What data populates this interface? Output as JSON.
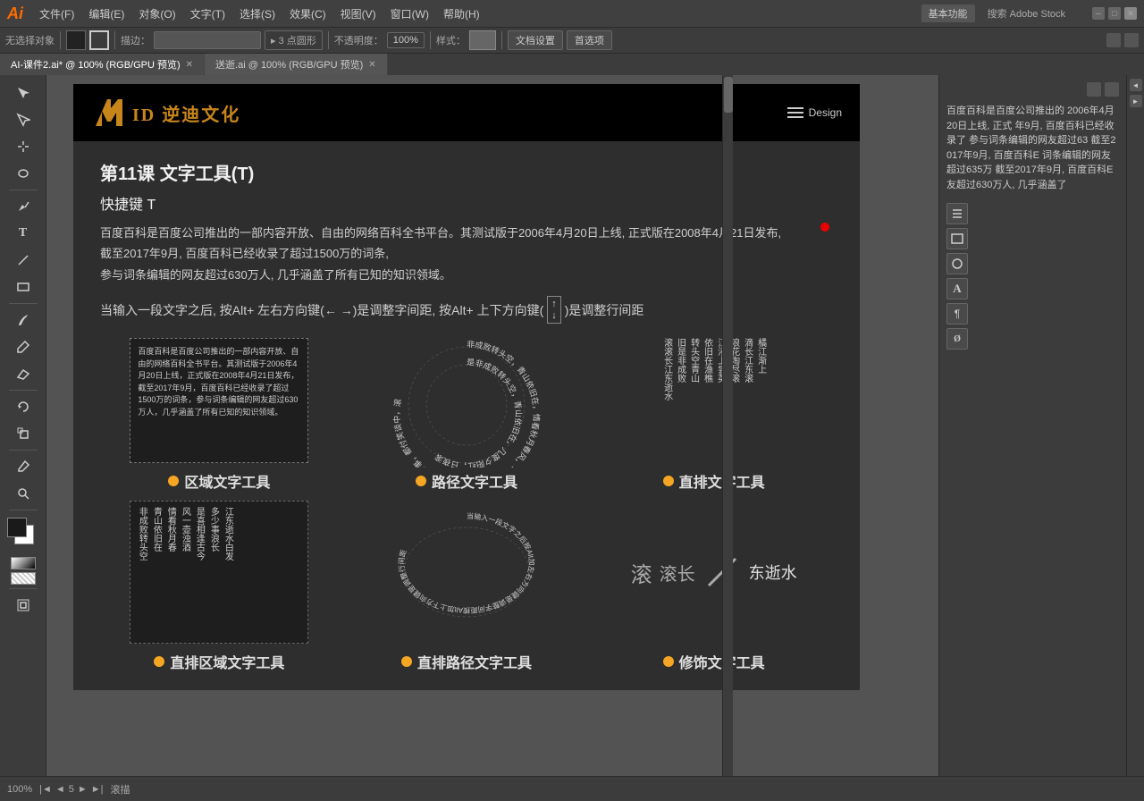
{
  "app": {
    "logo": "Ai",
    "menu_items": [
      "文件(F)",
      "编辑(E)",
      "对象(O)",
      "文字(T)",
      "选择(S)",
      "效果(C)",
      "视图(V)",
      "窗口(W)",
      "帮助(H)"
    ],
    "right_menu": [
      "基本功能",
      "搜索 Adobe Stock"
    ],
    "workspace_label": "基本功能"
  },
  "toolbar": {
    "no_selection": "无选择对象",
    "fill_label": "",
    "stroke_label": "",
    "scatter": "描边：",
    "points": "▸ 3 点圆形",
    "opacity_label": "不透明度：",
    "opacity_value": "100%",
    "style_label": "样式：",
    "doc_settings": "文档设置",
    "preferences": "首选项"
  },
  "tabs": [
    {
      "label": "AI-课件2.ai* @ 100% (RGB/GPU 预览)",
      "active": true
    },
    {
      "label": "送逝.ai @ 100% (RGB/GPU 预览)",
      "active": false
    }
  ],
  "slide": {
    "brand": "ID 逆迪文化",
    "design_menu": "Design",
    "lesson_title": "第11课   文字工具(T)",
    "shortcut": "快捷键 T",
    "desc_text": "百度百科是百度公司推出的一部内容开放、自由的网络百科全书平台。其测试版于2006年4月20日上线, 正式版在2008年4月21日发布,\n截至2017年9月, 百度百科已经收录了超过1500万的词条,\n参与词条编辑的网友超过630万人, 几乎涵盖了所有已知的知识领域。",
    "alt_text": "当输入一段文字之后, 按Alt+ 左右方向键(← →)是调整字间距, 按Alt+ 上下方向键(   )是调整行间距",
    "tools": [
      {
        "id": "area-text",
        "label": "区域文字工具",
        "sample_text": "百度百科是百度公司推出的一部内容开放、自由的网络百科全书平台。其测试版于2006年4月20日上线，正式版在2008年4月21日发布，截至2017年9月，百度百科已经收录了超过1500万的词条，参与词条编辑的网友超过630万人，几乎涵盖了所有已知的知识领域。"
      },
      {
        "id": "path-text",
        "label": "路径文字工具",
        "sample_text": "非成败转头空，青山依旧在，情看秋月春风，一壶浊酒喜相逢，古今多少事，都付笑谈中，滚滚长江东逝水，浪花淘尽英雄，是非成败转头空，青山依旧在，几度夕阳红，日夜滚滚长江东逝水"
      },
      {
        "id": "vertical-text",
        "label": "直排文字工具",
        "sample_text": "滚滚长江东逝水旧是非成败转头空青山依旧在渔樵江渚上尝英浪花淘尽滚滴长江东滚橘江渐上"
      }
    ],
    "tools_bottom": [
      {
        "id": "vertical-area",
        "label": "直排区域文字工具"
      },
      {
        "id": "vertical-path",
        "label": "直排路径文字工具"
      },
      {
        "id": "decoration",
        "label": "修饰文字工具"
      }
    ]
  },
  "right_panel": {
    "text": "百度百科是百度公司推出的 2006年4月20日上线, 正式 年9月, 百度百科已经收录了 参与词条编辑的网友超过63 截至2017年9月, 百度百科E 词条编辑的网友超过635万 截至2017年9月, 百度百科E 友超过630万人, 几乎涵盖了"
  },
  "status_bar": {
    "zoom": "100%",
    "page": "5",
    "total_pages": "5",
    "nav_prev": "◄",
    "nav_next": "►",
    "info": "滚描"
  },
  "icons": {
    "selection": "↖",
    "direct_selection": "↗",
    "magic_wand": "✦",
    "lasso": "⌖",
    "pen": "✒",
    "type": "T",
    "line": "/",
    "rectangle": "▭",
    "paintbrush": "🖌",
    "pencil": "✏",
    "rotate": "↻",
    "scale": "⊡",
    "shaper": "◈",
    "eraser": "◻",
    "zoom": "⊕",
    "hand": "✋"
  }
}
